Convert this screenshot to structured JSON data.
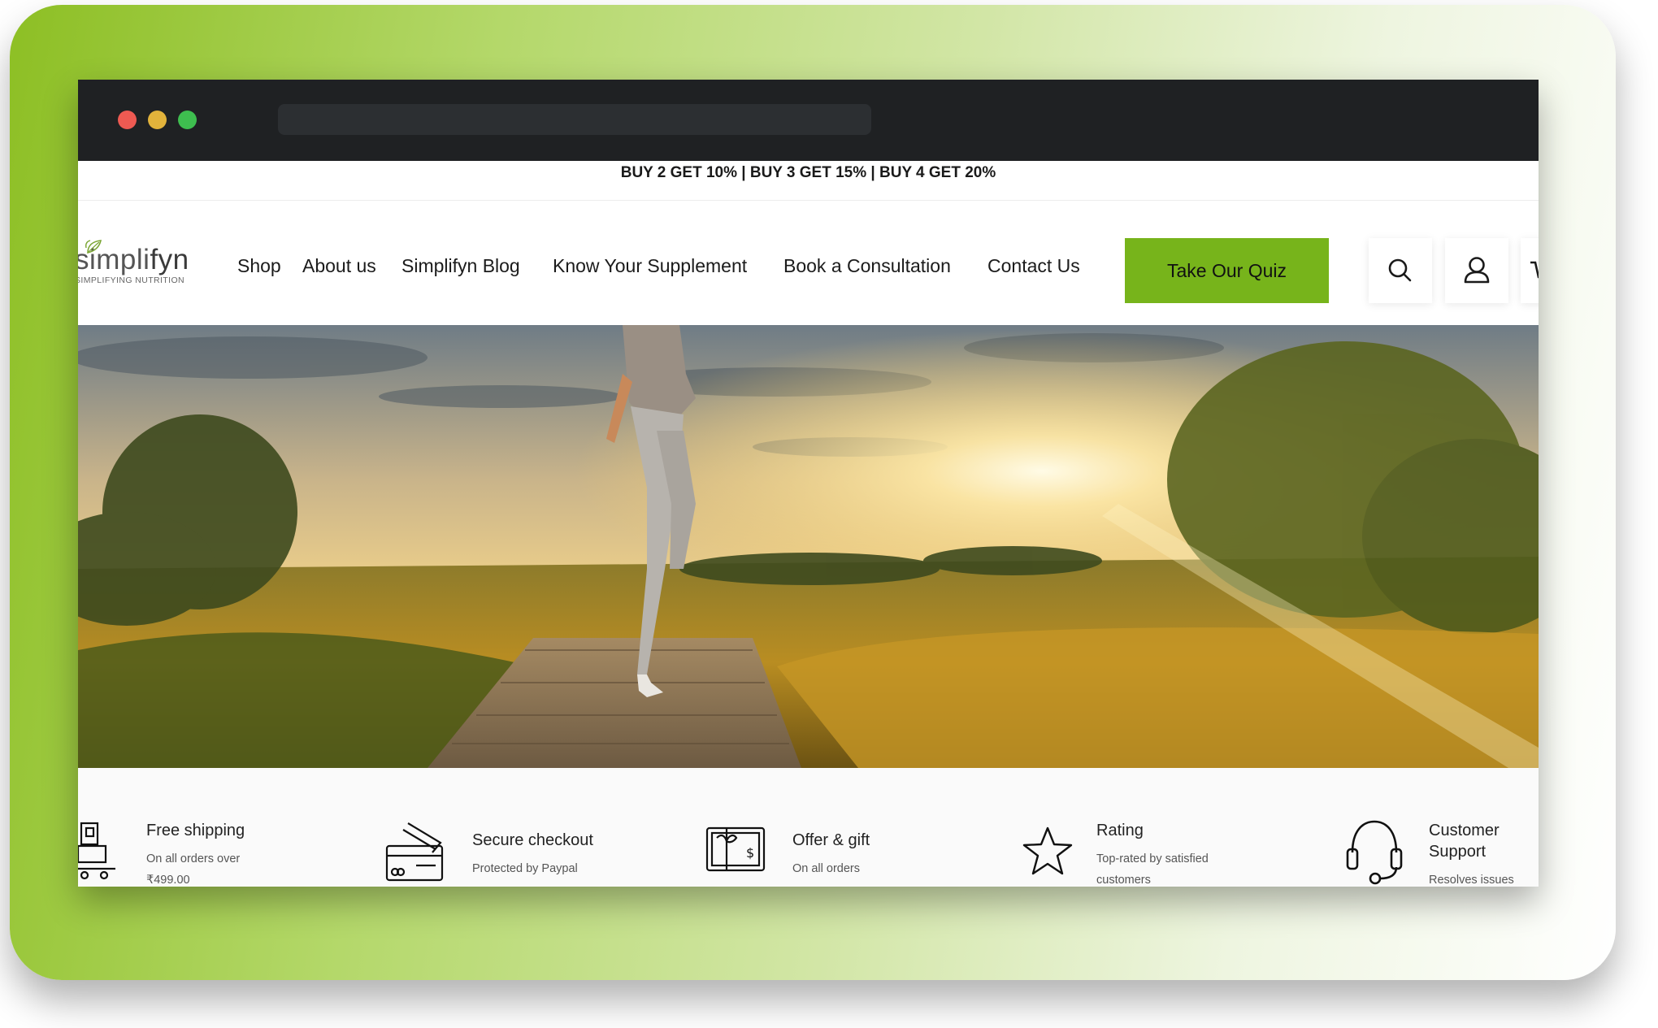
{
  "promo_bar": {
    "text": "BUY 2 GET 10% | BUY 3 GET 15% | BUY 4 GET 20%"
  },
  "brand": {
    "name_part1": "simpli",
    "name_part2": "fyn",
    "tagline": "SIMPLIFYING NUTRITION"
  },
  "nav": {
    "items": [
      "Shop",
      "About us",
      "Simplifyn Blog",
      "Know Your Supplement",
      "Book a Consultation",
      "Contact Us"
    ]
  },
  "cta": {
    "label": "Take Our Quiz"
  },
  "header_icons": [
    "search-icon",
    "account-icon",
    "cart-icon"
  ],
  "features": [
    {
      "icon": "delivery-cart-icon",
      "title": "Free shipping",
      "subtitle_line1": "On all orders over",
      "subtitle_line2": "₹499.00"
    },
    {
      "icon": "credit-card-icon",
      "title": "Secure checkout",
      "subtitle_line1": "Protected by Paypal",
      "subtitle_line2": ""
    },
    {
      "icon": "gift-card-icon",
      "title": "Offer & gift",
      "subtitle_line1": "On all orders",
      "subtitle_line2": ""
    },
    {
      "icon": "star-icon",
      "title": "Rating",
      "subtitle_line1": "Top-rated by satisfied",
      "subtitle_line2": "customers"
    },
    {
      "icon": "headset-icon",
      "title_line1": "Customer",
      "title_line2": "Support",
      "subtitle_line1": "Resolves issues",
      "subtitle_line2": ""
    }
  ],
  "colors": {
    "accent": "#77b41b",
    "titlebar": "#1f2123",
    "close": "#ee5a52",
    "minimize": "#e2b33b",
    "maximize": "#3ebe4f"
  }
}
